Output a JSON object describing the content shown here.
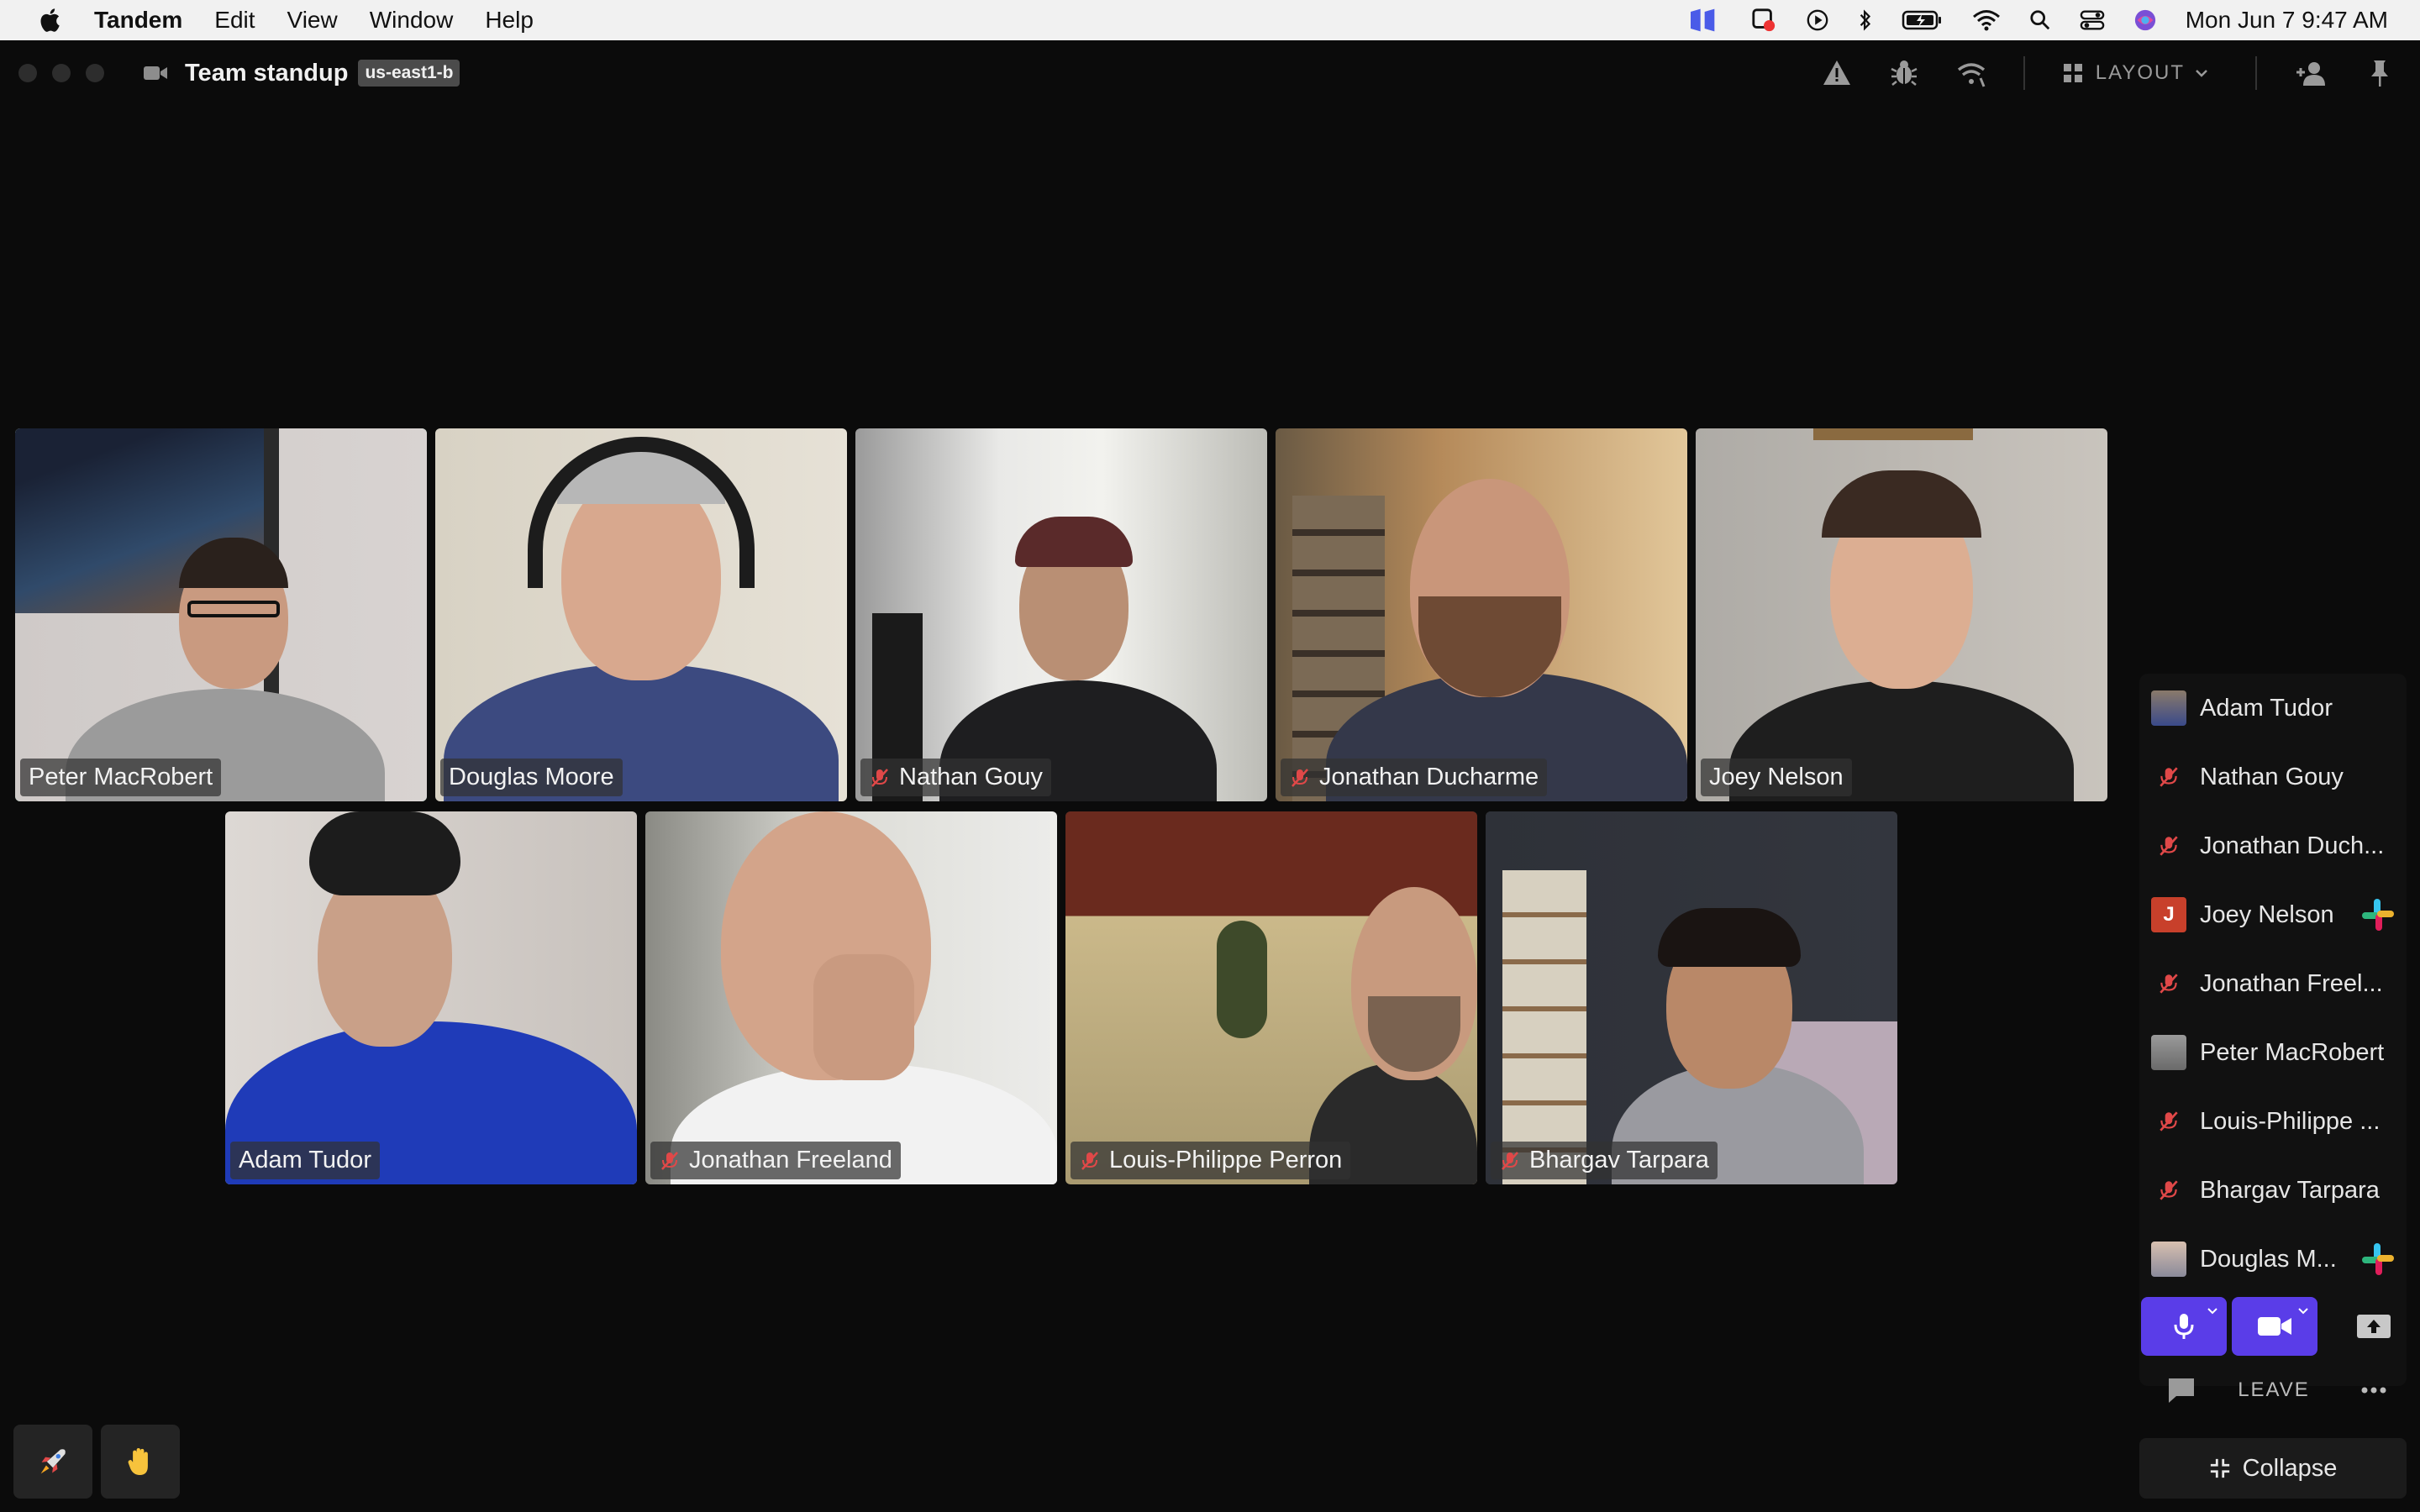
{
  "menubar": {
    "app_name": "Tandem",
    "items": [
      "Edit",
      "View",
      "Window",
      "Help"
    ],
    "clock": "Mon Jun 7  9:47 AM"
  },
  "window": {
    "title": "Team standup",
    "region": "us-east1-b",
    "layout_label": "LAYOUT"
  },
  "tiles": [
    {
      "name": "Peter MacRobert",
      "muted": false,
      "active": true
    },
    {
      "name": "Douglas Moore",
      "muted": false,
      "active": false
    },
    {
      "name": "Nathan Gouy",
      "muted": true,
      "active": false
    },
    {
      "name": "Jonathan Ducharme",
      "muted": true,
      "active": false
    },
    {
      "name": "Joey Nelson",
      "muted": false,
      "active": false
    },
    {
      "name": "Adam Tudor",
      "muted": false,
      "active": false
    },
    {
      "name": "Jonathan Freeland",
      "muted": true,
      "active": false
    },
    {
      "name": "Louis-Philippe Perron",
      "muted": true,
      "active": false
    },
    {
      "name": "Bhargav Tarpara",
      "muted": true,
      "active": false
    }
  ],
  "participants": [
    {
      "name": "Adam Tudor",
      "avatar": "photo",
      "slack": false
    },
    {
      "name": "Nathan Gouy",
      "avatar": "muted",
      "slack": false
    },
    {
      "name": "Jonathan Duch...",
      "avatar": "muted",
      "slack": false
    },
    {
      "name": "Joey Nelson",
      "avatar": "letter",
      "letter": "J",
      "slack": true
    },
    {
      "name": "Jonathan Freel...",
      "avatar": "muted",
      "slack": false
    },
    {
      "name": "Peter MacRobert",
      "avatar": "photo",
      "slack": false
    },
    {
      "name": "Louis-Philippe ...",
      "avatar": "muted",
      "slack": false
    },
    {
      "name": "Bhargav Tarpara",
      "avatar": "muted",
      "slack": false
    },
    {
      "name": "Douglas M...",
      "avatar": "photo",
      "slack": true
    }
  ],
  "controls": {
    "leave_label": "LEAVE",
    "collapse_label": "Collapse"
  },
  "colors": {
    "accent": "#5a3de8",
    "active_speaker": "#4fc39a",
    "letter_avatar": "#c8402b"
  }
}
